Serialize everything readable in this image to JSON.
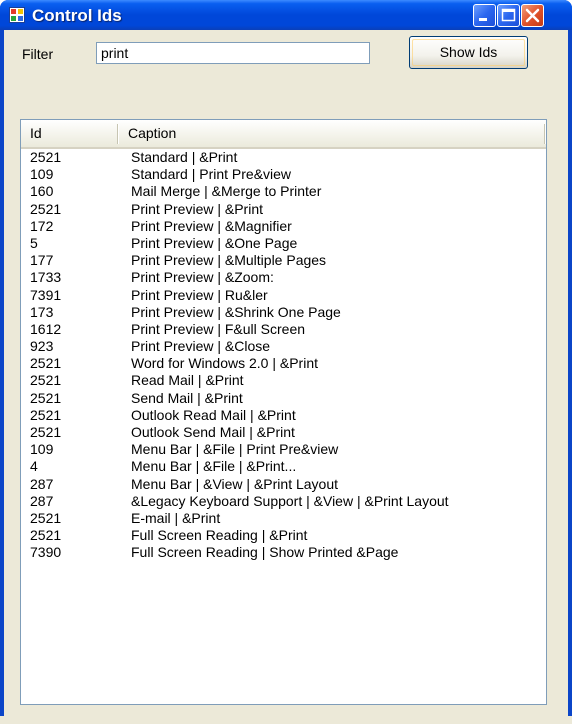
{
  "window": {
    "title": "Control Ids"
  },
  "filter": {
    "label": "Filter",
    "value": "print"
  },
  "show_button": {
    "label": "Show Ids"
  },
  "list": {
    "columns": [
      "Id",
      "Caption"
    ],
    "rows": [
      {
        "id": "2521",
        "caption": "Standard  |  &Print"
      },
      {
        "id": "109",
        "caption": "Standard  |  Print Pre&view"
      },
      {
        "id": "160",
        "caption": "Mail Merge  |  &Merge to Printer"
      },
      {
        "id": "2521",
        "caption": "Print Preview  |  &Print"
      },
      {
        "id": "172",
        "caption": "Print Preview  |  &Magnifier"
      },
      {
        "id": "5",
        "caption": "Print Preview  |  &One Page"
      },
      {
        "id": "177",
        "caption": "Print Preview  |  &Multiple Pages"
      },
      {
        "id": "1733",
        "caption": "Print Preview  |  &Zoom:"
      },
      {
        "id": "7391",
        "caption": "Print Preview  |  Ru&ler"
      },
      {
        "id": "173",
        "caption": "Print Preview  |  &Shrink One Page"
      },
      {
        "id": "1612",
        "caption": "Print Preview  |  F&ull Screen"
      },
      {
        "id": "923",
        "caption": "Print Preview  |  &Close"
      },
      {
        "id": "2521",
        "caption": "Word for Windows 2.0  |  &Print"
      },
      {
        "id": "2521",
        "caption": "Read Mail  |  &Print"
      },
      {
        "id": "2521",
        "caption": "Send Mail  |  &Print"
      },
      {
        "id": "2521",
        "caption": "Outlook Read Mail  |  &Print"
      },
      {
        "id": "2521",
        "caption": "Outlook Send Mail  |  &Print"
      },
      {
        "id": "109",
        "caption": "Menu Bar  |  &File  |  Print Pre&view"
      },
      {
        "id": "4",
        "caption": "Menu Bar  |  &File  |  &Print..."
      },
      {
        "id": "287",
        "caption": "Menu Bar  |  &View  |  &Print Layout"
      },
      {
        "id": "287",
        "caption": "&Legacy Keyboard Support  |  &View  |  &Print Layout"
      },
      {
        "id": "2521",
        "caption": "E-mail  |  &Print"
      },
      {
        "id": "2521",
        "caption": "Full Screen Reading  |  &Print"
      },
      {
        "id": "7390",
        "caption": "Full Screen Reading  |  Show Printed &Page"
      }
    ]
  },
  "colors": {
    "titlebar": "#0047d9",
    "close_button": "#e2542c",
    "face": "#ece9d8"
  }
}
